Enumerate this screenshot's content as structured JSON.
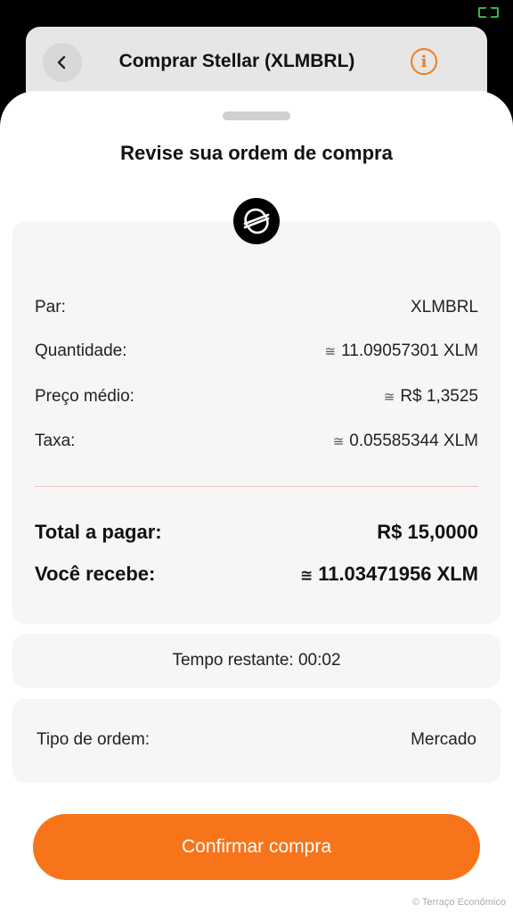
{
  "header": {
    "title": "Comprar Stellar (XLMBRL)",
    "info_label": "i"
  },
  "sheet": {
    "title": "Revise sua ordem de compra"
  },
  "summary": {
    "approx_symbol": "≅",
    "pair": {
      "label": "Par:",
      "value": "XLMBRL"
    },
    "quantity": {
      "label": "Quantidade:",
      "value": "11.09057301 XLM"
    },
    "avg_price": {
      "label": "Preço médio:",
      "value": "R$ 1,3525"
    },
    "fee": {
      "label": "Taxa:",
      "value": "0.05585344 XLM"
    },
    "total": {
      "label": "Total a pagar:",
      "value": "R$ 15,0000"
    },
    "receive": {
      "label": "Você recebe:",
      "value": "11.03471956 XLM"
    }
  },
  "timer": {
    "text": "Tempo restante: 00:02"
  },
  "order": {
    "label": "Tipo de ordem:",
    "value": "Mercado"
  },
  "confirm_button": {
    "label": "Confirmar compra"
  },
  "watermark": "© Terraço Econômico",
  "colors": {
    "accent": "#f7741a",
    "card_bg": "#f6f6f6"
  },
  "icons": {
    "back": "chevron-left-icon",
    "info": "info-icon",
    "coin": "stellar-logo-icon"
  }
}
